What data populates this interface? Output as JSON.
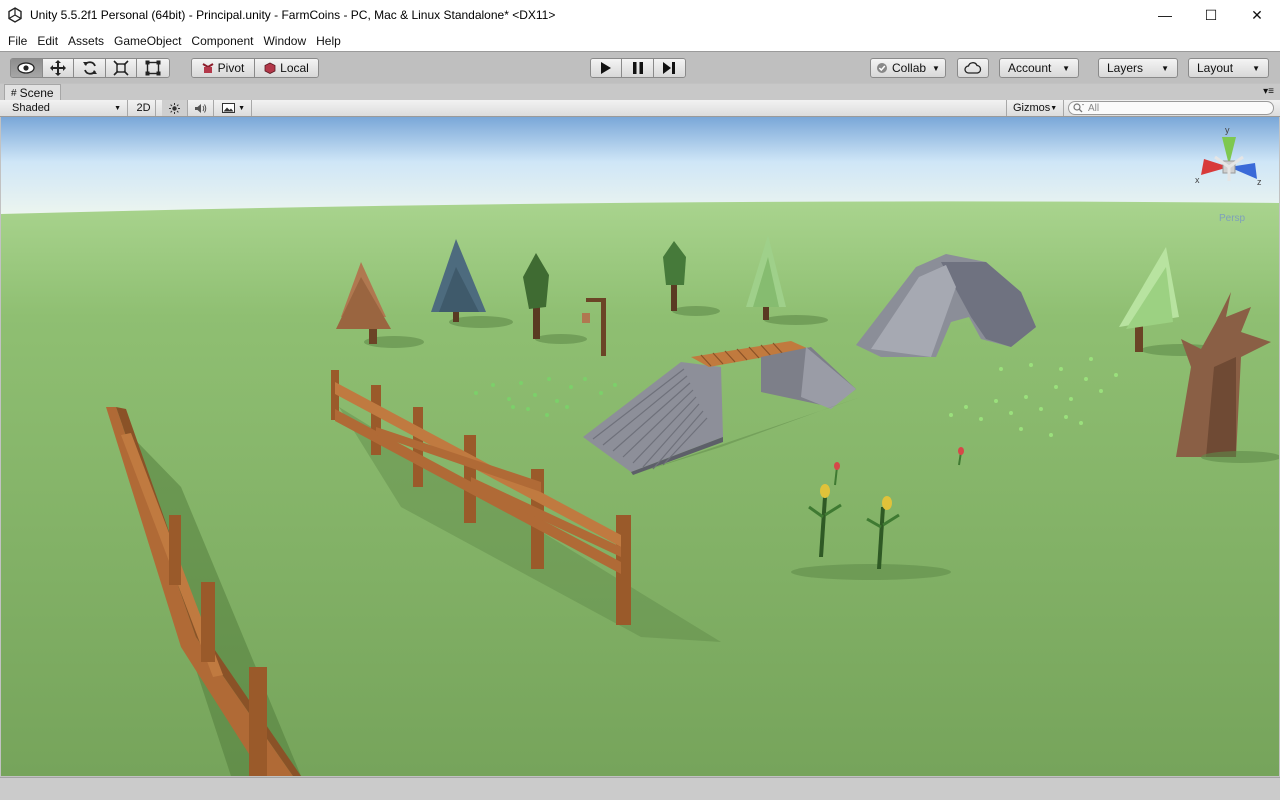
{
  "window": {
    "title": "Unity 5.5.2f1 Personal (64bit) - Principal.unity - FarmCoins - PC, Mac & Linux Standalone* <DX11>",
    "minimize_glyph": "—",
    "maximize_glyph": "☐",
    "close_glyph": "✕"
  },
  "menu": [
    "File",
    "Edit",
    "Assets",
    "GameObject",
    "Component",
    "Window",
    "Help"
  ],
  "toolbar": {
    "pivot_label": "Pivot",
    "local_label": "Local",
    "collab_label": "Collab",
    "account_label": "Account",
    "layers_label": "Layers",
    "layout_label": "Layout"
  },
  "scene": {
    "tab_label": "Scene",
    "shading_mode": "Shaded",
    "mode_2d": "2D",
    "gizmos_label": "Gizmos",
    "search_placeholder": "All",
    "gizmo_persp": "Persp",
    "gizmo_x": "x",
    "gizmo_y": "y",
    "gizmo_z": "z"
  },
  "colors": {
    "ground": "#7fae63",
    "sky": "#cfe6f7",
    "fence": "#b06a36",
    "stone": "#7d7f89"
  }
}
